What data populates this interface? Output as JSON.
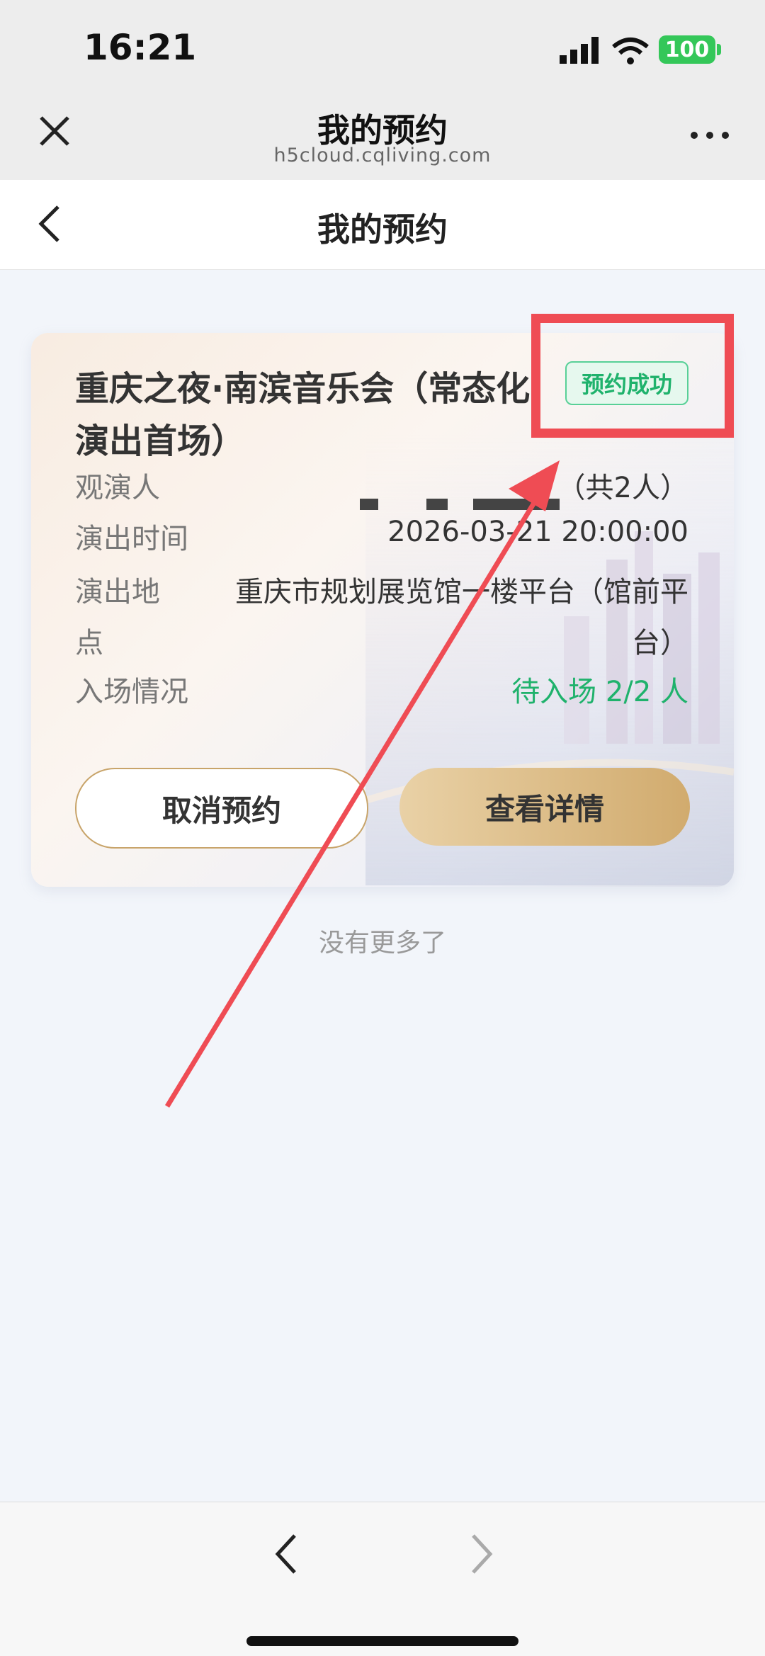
{
  "status_bar": {
    "time": "16:21",
    "battery": "100"
  },
  "wechat_bar": {
    "title": "我的预约",
    "domain": "h5cloud.cqliving.com"
  },
  "header": {
    "title": "我的预约"
  },
  "card": {
    "title": "重庆之夜·南滨音乐会（常态化演出首场）",
    "status": "预约成功",
    "rows": [
      {
        "label": "观演人",
        "value": "（共2人）"
      },
      {
        "label": "演出时间",
        "value": "2026-03-21 20:00:00"
      },
      {
        "label": "演出地点",
        "value": "重庆市规划展览馆一楼平台（馆前平台）"
      },
      {
        "label": "入场情况",
        "value": "待入场 2/2 人"
      }
    ],
    "cancel_label": "取消预约",
    "detail_label": "查看详情"
  },
  "footer_text": "没有更多了",
  "colors": {
    "accent_green": "#1fb26c",
    "highlight_red": "#ef4c54",
    "gold": "#d1ab6e"
  }
}
